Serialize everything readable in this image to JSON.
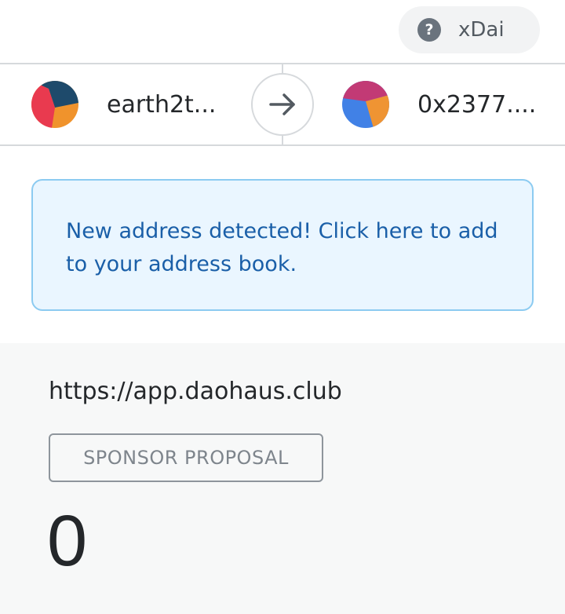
{
  "network": {
    "label": "xDai",
    "icon": "help-icon"
  },
  "accounts": {
    "from": {
      "name": "earth2t...",
      "avatar_colors": [
        "#1e4a6b",
        "#f0932c",
        "#e93a4f"
      ]
    },
    "to": {
      "name": "0x2377....",
      "avatar_colors": [
        "#c23a75",
        "#ef9433",
        "#4181e6"
      ]
    },
    "arrow_icon": "arrow-right-icon"
  },
  "notice": {
    "text": "New address detected! Click here to add to your address book."
  },
  "details": {
    "origin": "https://app.daohaus.club",
    "method": "SPONSOR PROPOSAL",
    "amount": "0"
  }
}
